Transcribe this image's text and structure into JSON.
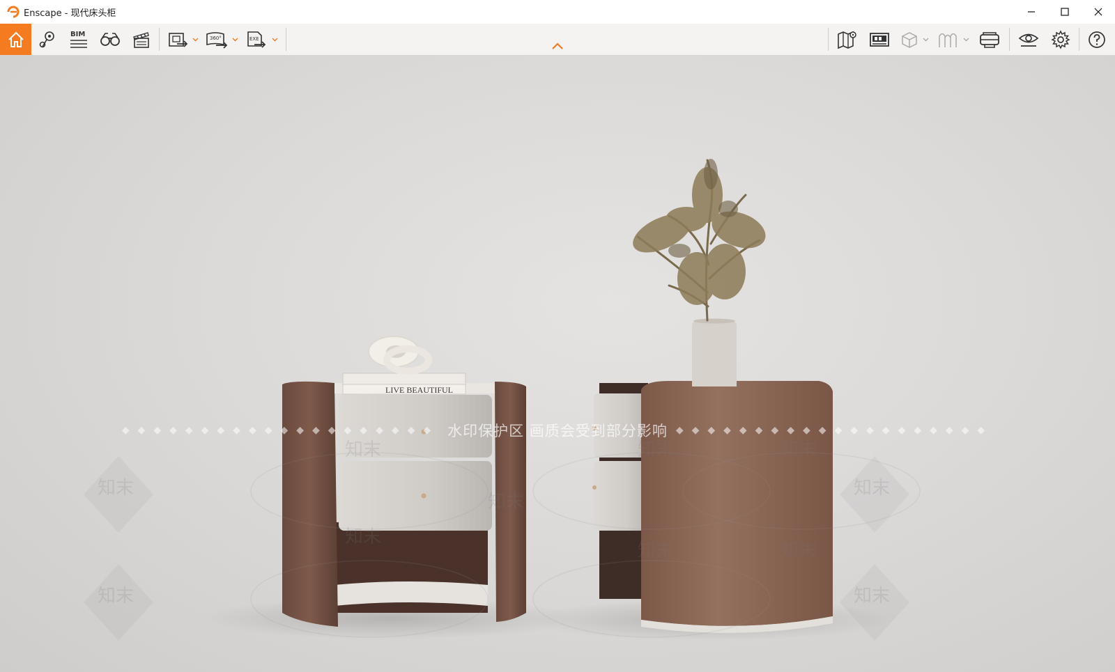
{
  "window": {
    "app_name": "Enscape",
    "title": "Enscape - 现代床头柜",
    "controls": [
      "minimize",
      "maximize",
      "close"
    ]
  },
  "toolbar": {
    "left_tools": [
      {
        "name": "home",
        "icon": "home-icon",
        "active": true
      },
      {
        "name": "views",
        "icon": "location-pin-icon"
      },
      {
        "name": "bim",
        "icon": "bim-icon",
        "label": "BIM"
      },
      {
        "name": "binoculars",
        "icon": "binoculars-icon"
      },
      {
        "name": "video",
        "icon": "clapperboard-icon"
      },
      {
        "name": "export-image",
        "icon": "export-image-icon"
      },
      {
        "name": "export-panorama",
        "icon": "export-360-icon",
        "label": "360°"
      },
      {
        "name": "export-exe",
        "icon": "export-exe-icon",
        "label": "EXE"
      }
    ],
    "right_tools": [
      {
        "name": "map",
        "icon": "map-icon"
      },
      {
        "name": "asset-library",
        "icon": "asset-library-icon"
      },
      {
        "name": "section-box",
        "icon": "cube-icon"
      },
      {
        "name": "material",
        "icon": "material-icon"
      },
      {
        "name": "vr",
        "icon": "vr-headset-icon"
      },
      {
        "name": "visual-settings",
        "icon": "eye-icon"
      },
      {
        "name": "settings",
        "icon": "gear-icon"
      },
      {
        "name": "help",
        "icon": "help-icon"
      }
    ],
    "accent_color": "#f47b20"
  },
  "viewport": {
    "book_text": "LIVE BEAUTIFUL",
    "watermark_main": "水印保护区   画质会受到部分影响",
    "watermark_brand": "知末"
  }
}
